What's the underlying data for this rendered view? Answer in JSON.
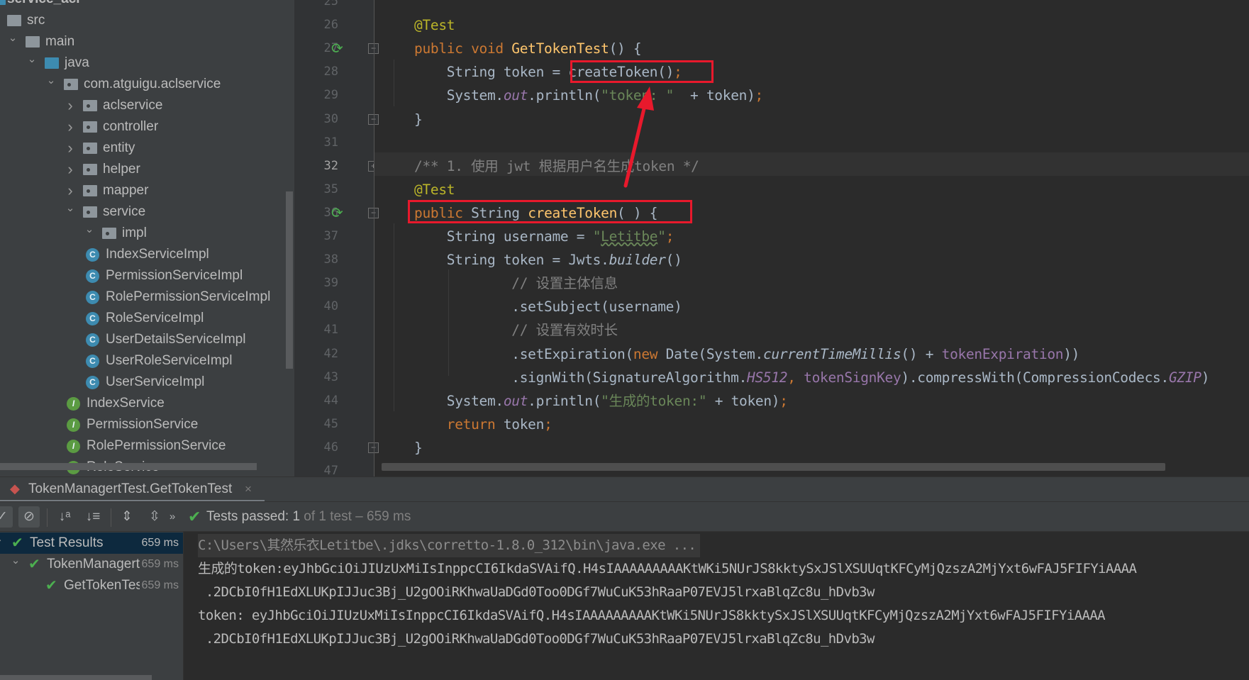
{
  "project_tree": [
    {
      "label": "service_acl",
      "depth": 0,
      "type": "module",
      "chevron": ""
    },
    {
      "label": "src",
      "depth": 0,
      "type": "folder",
      "chevron": ""
    },
    {
      "label": "main",
      "depth": 0,
      "type": "folder",
      "chevron": "down"
    },
    {
      "label": "java",
      "depth": 1,
      "type": "source",
      "chevron": "down"
    },
    {
      "label": "com.atguigu.aclservice",
      "depth": 2,
      "type": "package",
      "chevron": "down"
    },
    {
      "label": "aclservice",
      "depth": 3,
      "type": "package",
      "chevron": "right"
    },
    {
      "label": "controller",
      "depth": 3,
      "type": "package",
      "chevron": "right"
    },
    {
      "label": "entity",
      "depth": 3,
      "type": "package",
      "chevron": "right"
    },
    {
      "label": "helper",
      "depth": 3,
      "type": "package",
      "chevron": "right"
    },
    {
      "label": "mapper",
      "depth": 3,
      "type": "package",
      "chevron": "right"
    },
    {
      "label": "service",
      "depth": 3,
      "type": "package",
      "chevron": "down"
    },
    {
      "label": "impl",
      "depth": 4,
      "type": "package",
      "chevron": "down"
    },
    {
      "label": "IndexServiceImpl",
      "depth": 5,
      "type": "class",
      "chevron": ""
    },
    {
      "label": "PermissionServiceImpl",
      "depth": 5,
      "type": "class",
      "chevron": ""
    },
    {
      "label": "RolePermissionServiceImpl",
      "depth": 5,
      "type": "class",
      "chevron": ""
    },
    {
      "label": "RoleServiceImpl",
      "depth": 5,
      "type": "class",
      "chevron": ""
    },
    {
      "label": "UserDetailsServiceImpl",
      "depth": 5,
      "type": "class",
      "chevron": ""
    },
    {
      "label": "UserRoleServiceImpl",
      "depth": 5,
      "type": "class",
      "chevron": ""
    },
    {
      "label": "UserServiceImpl",
      "depth": 5,
      "type": "class",
      "chevron": ""
    },
    {
      "label": "IndexService",
      "depth": 4,
      "type": "interface",
      "chevron": ""
    },
    {
      "label": "PermissionService",
      "depth": 4,
      "type": "interface",
      "chevron": ""
    },
    {
      "label": "RolePermissionService",
      "depth": 4,
      "type": "interface",
      "chevron": ""
    },
    {
      "label": "RoleService",
      "depth": 4,
      "type": "interface",
      "chevron": ""
    }
  ],
  "editor": {
    "current_line": "32",
    "lines": [
      {
        "num": "25",
        "tokens": []
      },
      {
        "num": "26",
        "tokens": [
          [
            "@Test",
            "a"
          ]
        ]
      },
      {
        "num": "27",
        "run": true,
        "fold": "-",
        "tokens": [
          [
            "public void ",
            "k"
          ],
          [
            "GetTokenTest",
            "m"
          ],
          [
            "() {",
            ""
          ]
        ]
      },
      {
        "num": "28",
        "tokens": [
          [
            "    String token = createToken()",
            ""
          ],
          [
            ";",
            "k"
          ]
        ]
      },
      {
        "num": "29",
        "tokens": [
          [
            "    System.",
            ""
          ],
          [
            "out",
            "f"
          ],
          [
            ".println(",
            ""
          ],
          [
            "\"token: \"",
            "s"
          ],
          [
            "  + token)",
            ""
          ],
          [
            ";",
            "k"
          ]
        ]
      },
      {
        "num": "30",
        "fold": "-",
        "tokens": [
          [
            "}",
            ""
          ]
        ]
      },
      {
        "num": "31",
        "tokens": []
      },
      {
        "num": "32",
        "fold": "+",
        "tokens": [
          [
            "/** 1. 使用 jwt 根据用户名生成token */",
            "c"
          ]
        ]
      },
      {
        "num": "35",
        "tokens": [
          [
            "@Test",
            "a"
          ]
        ]
      },
      {
        "num": "36",
        "run": true,
        "fold": "-",
        "tokens": [
          [
            "public ",
            "k"
          ],
          [
            "String ",
            ""
          ],
          [
            "createToken",
            "m"
          ],
          [
            "( ) {",
            ""
          ]
        ]
      },
      {
        "num": "37",
        "tokens": [
          [
            "    String username = ",
            ""
          ],
          [
            "\"",
            "s"
          ],
          [
            "Letitbe",
            "s u"
          ],
          [
            "\"",
            "s"
          ],
          [
            ";",
            "k"
          ]
        ]
      },
      {
        "num": "38",
        "tokens": [
          [
            "    String token = Jwts.",
            ""
          ],
          [
            "builder",
            "i"
          ],
          [
            "()",
            ""
          ]
        ]
      },
      {
        "num": "39",
        "tokens": [
          [
            "            // 设置主体信息",
            "c"
          ]
        ]
      },
      {
        "num": "40",
        "tokens": [
          [
            "            .setSubject(username)",
            ""
          ]
        ]
      },
      {
        "num": "41",
        "tokens": [
          [
            "            // 设置有效时长",
            "c"
          ]
        ]
      },
      {
        "num": "42",
        "tokens": [
          [
            "            .setExpiration(",
            ""
          ],
          [
            "new ",
            "k"
          ],
          [
            "Date(System.",
            ""
          ],
          [
            "currentTimeMillis",
            "i"
          ],
          [
            "() + ",
            ""
          ],
          [
            "tokenExpiration",
            "fp"
          ],
          [
            "))",
            ""
          ]
        ]
      },
      {
        "num": "43",
        "tokens": [
          [
            "            .signWith(SignatureAlgorithm.",
            ""
          ],
          [
            "HS512",
            "f"
          ],
          [
            ", ",
            "k"
          ],
          [
            "tokenSignKey",
            "fp"
          ],
          [
            ").compressWith(CompressionCodecs.",
            ""
          ],
          [
            "GZIP",
            "f"
          ],
          [
            ")",
            ""
          ]
        ]
      },
      {
        "num": "44",
        "tokens": [
          [
            "    System.",
            ""
          ],
          [
            "out",
            "f"
          ],
          [
            ".println(",
            ""
          ],
          [
            "\"生成的token:\"",
            "s"
          ],
          [
            " + token)",
            ""
          ],
          [
            ";",
            "k"
          ]
        ]
      },
      {
        "num": "45",
        "tokens": [
          [
            "    ",
            ""
          ],
          [
            "return ",
            "k"
          ],
          [
            "token",
            ""
          ],
          [
            ";",
            "k"
          ]
        ]
      },
      {
        "num": "46",
        "fold": "-",
        "tokens": [
          [
            "}",
            ""
          ]
        ]
      },
      {
        "num": "47",
        "tokens": []
      }
    ]
  },
  "run_tab": {
    "label": "TokenManagertTest.GetTokenTest",
    "close": "×"
  },
  "toolbar": {
    "status_prefix": "Tests passed: ",
    "passed": "1",
    "status_suffix": " of 1 test – 659 ms",
    "more": "»"
  },
  "test_results": [
    {
      "label": "Test Results",
      "time": "659 ms",
      "selected": true
    },
    {
      "label": "TokenManagertTest",
      "time": "659 ms",
      "chevron": "down"
    },
    {
      "label": "GetTokenTest",
      "time": "659 ms"
    }
  ],
  "console": [
    "C:\\Users\\其然乐衣Letitbe\\.jdks\\corretto-1.8.0_312\\bin\\java.exe ...",
    "生成的token:eyJhbGciOiJIUzUxMiIsInppcCI6IkdaSVAifQ.H4sIAAAAAAAAAKtWKi5NUrJS8kktySxJSlXSUUqtKFCyMjQzszA2MjYxt6wFAJ5FIFYiAAAA",
    " .2DCbI0fH1EdXLUKpIJJuc3Bj_U2gOOiRKhwaUaDGd0Too0DGf7WuCuK53hRaaP07EVJ5lrxaBlqZc8u_hDvb3w",
    "token: eyJhbGciOiJIUzUxMiIsInppcCI6IkdaSVAifQ.H4sIAAAAAAAAAKtWKi5NUrJS8kktySxJSlXSUUqtKFCyMjQzszA2MjYxt6wFAJ5FIFYiAAAA",
    " .2DCbI0fH1EdXLUKpIJJuc3Bj_U2gOOiRKhwaUaDGd0Too0DGf7WuCuK53hRaaP07EVJ5lrxaBlqZc8u_hDvb3w"
  ],
  "colors": {
    "keyword": "#cc7832",
    "annotation": "#bbb529",
    "string": "#6a8759",
    "pass": "#4caf50",
    "highlight_box": "#e8192c"
  }
}
